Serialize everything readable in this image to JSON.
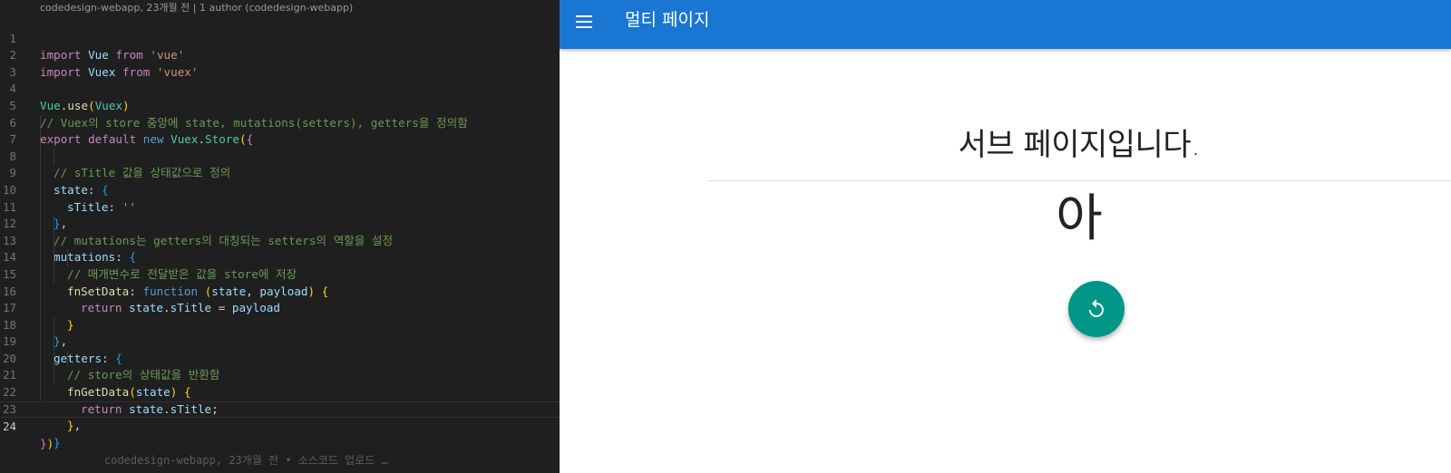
{
  "editor": {
    "codelens": "codedesign-webapp, 23개월 전 | 1 author (codedesign-webapp)",
    "line_numbers": [
      "1",
      "2",
      "3",
      "4",
      "5",
      "6",
      "7",
      "8",
      "9",
      "10",
      "11",
      "12",
      "13",
      "14",
      "15",
      "16",
      "17",
      "18",
      "19",
      "20",
      "21",
      "22",
      "23",
      "24"
    ],
    "code": {
      "l1": [
        "import",
        "Vue",
        "from",
        "'vue'"
      ],
      "l2": [
        "import",
        "Vuex",
        "from",
        "'vuex'"
      ],
      "l4": [
        "Vue",
        ".",
        "use",
        "(",
        "Vuex",
        ")"
      ],
      "l5": "// Vuex의 store 중앙에 state, mutations(setters), getters을 정의함",
      "l6": [
        "export",
        "default",
        "new",
        "Vuex",
        ".",
        "Store",
        "(",
        "{"
      ],
      "l7": "// sTitle 값을 상태값으로 정의",
      "l8": [
        "state",
        ":",
        "{"
      ],
      "l9": [
        "sTitle",
        ":",
        "''"
      ],
      "l10": [
        "}",
        ","
      ],
      "l11": "// mutations는 getters의 대칭되는 setters의 역할을 설정",
      "l12": [
        "mutations",
        ":",
        "{"
      ],
      "l13": "// 매개변수로 전달받은 값을 store에 저장",
      "l14": [
        "fnSetData",
        ":",
        "function",
        "(",
        "state",
        ",",
        "payload",
        ")",
        "{"
      ],
      "l15": [
        "return",
        "state",
        ".",
        "sTitle",
        "=",
        "payload"
      ],
      "l16": [
        "}"
      ],
      "l17": [
        "}",
        ","
      ],
      "l18": [
        "getters",
        ":",
        "{"
      ],
      "l19": "// store의 상태값을 반환함",
      "l20": [
        "fnGetData",
        "(",
        "state",
        ")",
        "{"
      ],
      "l21": [
        "return",
        "state",
        ".",
        "sTitle",
        ";"
      ],
      "l22": [
        "}",
        ","
      ],
      "l23": [
        "}"
      ],
      "l24": [
        "}",
        ")"
      ]
    },
    "inline_blame": "codedesign-webapp, 23개월 전 • 소스코드 업로드 …",
    "colors": {
      "background": "#1f1f1f",
      "keyword": "#c586c0",
      "variable": "#9cdcfe",
      "string": "#ce9178",
      "class": "#4ec9b0",
      "function": "#dcdcaa",
      "comment": "#6a9955"
    }
  },
  "app": {
    "title": "멀티 페이지",
    "menu_icon": "hamburger-menu-icon",
    "heading": "서브 페이지입니다.",
    "value_text": "아",
    "fab_icon": "refresh-icon",
    "colors": {
      "appbar": "#1976d2",
      "fab": "#009688"
    }
  }
}
